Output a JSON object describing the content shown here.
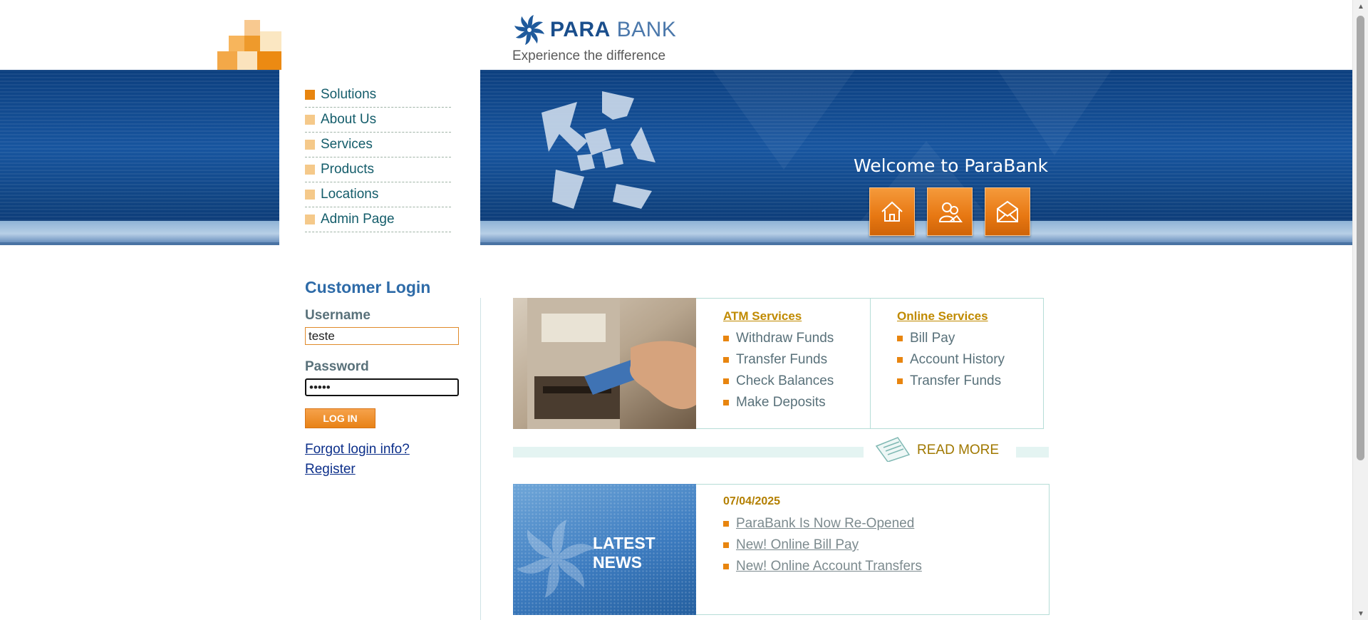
{
  "brand": {
    "name_bold": "PARA",
    "name_light": "BANK",
    "tagline": "Experience the difference"
  },
  "nav": {
    "items": [
      {
        "label": "Solutions",
        "active": true
      },
      {
        "label": "About Us"
      },
      {
        "label": "Services"
      },
      {
        "label": "Products"
      },
      {
        "label": "Locations"
      },
      {
        "label": "Admin Page"
      }
    ]
  },
  "hero": {
    "welcome": "Welcome to ParaBank",
    "buttons": [
      {
        "icon": "home-icon"
      },
      {
        "icon": "about-icon"
      },
      {
        "icon": "contact-icon"
      }
    ]
  },
  "login": {
    "title": "Customer Login",
    "username_label": "Username",
    "username_value": "teste",
    "password_label": "Password",
    "password_value": "•••••",
    "button_label": "LOG IN",
    "forgot_link": "Forgot login info?",
    "register_link": "Register"
  },
  "services": {
    "atm": {
      "heading": "ATM Services",
      "items": [
        "Withdraw Funds",
        "Transfer Funds",
        "Check Balances",
        "Make Deposits"
      ]
    },
    "online": {
      "heading": "Online Services",
      "items": [
        "Bill Pay",
        "Account History",
        "Transfer Funds"
      ]
    },
    "read_more": "READ MORE"
  },
  "news": {
    "image_title_line1": "LATEST",
    "image_title_line2": "NEWS",
    "date": "07/04/2025",
    "items": [
      "ParaBank Is Now Re-Opened",
      "New! Online Bill Pay",
      "New! Online Account Transfers"
    ]
  },
  "colors": {
    "brand_blue": "#1a4e8c",
    "accent_orange": "#e8850f",
    "link_blue": "#0c2f8a",
    "heading_gold": "#c08a00"
  }
}
